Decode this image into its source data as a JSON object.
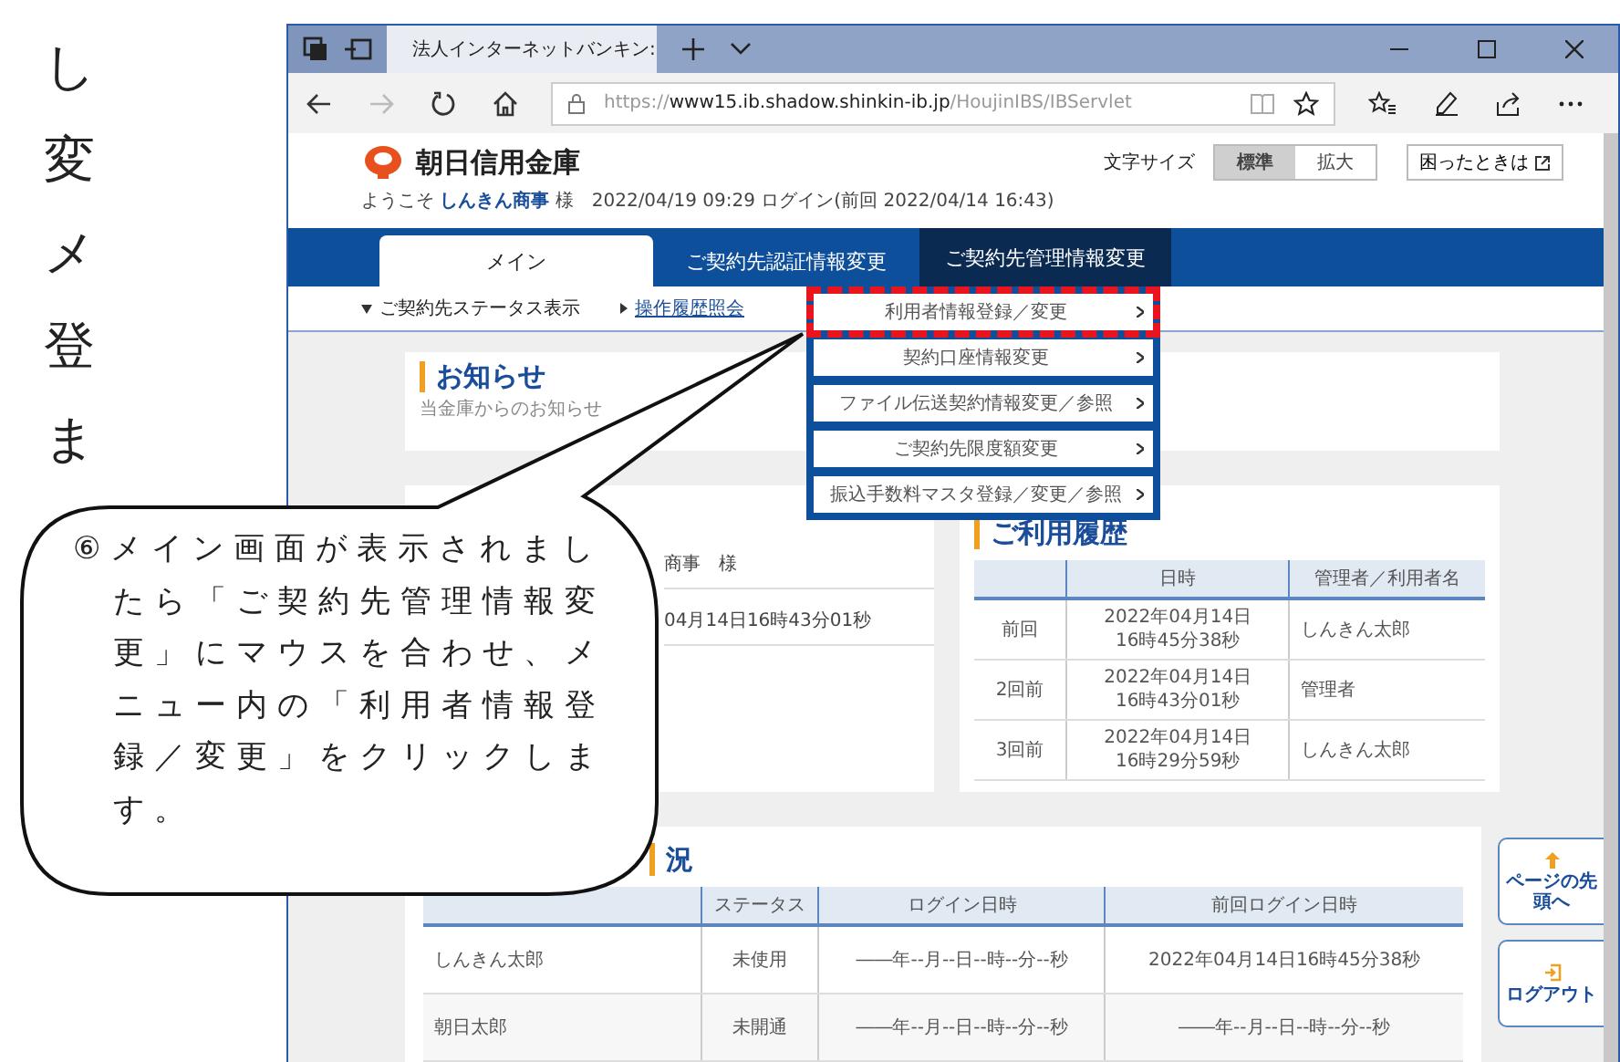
{
  "margin_text": [
    "し",
    "変",
    "メ",
    "登",
    "ま"
  ],
  "callout": {
    "text": "⑥メイン画面が表示されましたら「ご契約先管理情報変更」にマウスを合わせ、メニュー内の「利用者情報登録／変更」をクリックします。"
  },
  "browser": {
    "tab_title": "法人インターネットバンキン:",
    "url": {
      "scheme": "https://",
      "host": "www15.ib.shadow.shinkin-ib.jp",
      "path": "/HoujinIBS/IBServlet"
    }
  },
  "header": {
    "bank_name": "朝日信用金庫",
    "text_size_label": "文字サイズ",
    "text_sizes": [
      {
        "label": "標準",
        "selected": true
      },
      {
        "label": "拡大",
        "selected": false
      }
    ],
    "help_button": "困ったときは",
    "welcome": "ようこそ **しんきん商事** 様　2022/04/19 09:29 ログイン(前回 2022/04/14 16:43)"
  },
  "nav_tabs": [
    {
      "label": "メイン",
      "selected": true,
      "hovered": false
    },
    {
      "label": "ご契約先認証情報変更",
      "selected": false,
      "hovered": false
    },
    {
      "label": "ご契約先管理情報変更",
      "selected": false,
      "hovered": true
    }
  ],
  "sub_nav": [
    {
      "label": "ご契約先ステータス表示",
      "kind": "toggle"
    },
    {
      "label": "操作履歴照会",
      "kind": "link"
    }
  ],
  "dropdown_menu": [
    {
      "label": "利用者情報登録／変更",
      "highlighted": true
    },
    {
      "label": "契約口座情報変更",
      "highlighted": false
    },
    {
      "label": "ファイル伝送契約情報変更／参照",
      "highlighted": false
    },
    {
      "label": "ご契約先限度額変更",
      "highlighted": false
    },
    {
      "label": "振込手数料マスタ登録／変更／参照",
      "highlighted": false
    }
  ],
  "notice_card": {
    "title": "お知らせ",
    "text": "当金庫からのお知らせ"
  },
  "account_card": {
    "texts": [
      "商事　様",
      "04月14日16時43分01秒"
    ]
  },
  "history_card": {
    "title": "ご利用履歴",
    "columns": [
      "日時",
      "管理者／利用者名"
    ],
    "rows": [
      {
        "label": "前回",
        "date": "2022年04月14日",
        "time": "16時45分38秒",
        "user": "しんきん太郎"
      },
      {
        "label": "2回前",
        "date": "2022年04月14日",
        "time": "16時43分01秒",
        "user": "管理者"
      },
      {
        "label": "3回前",
        "date": "2022年04月14日",
        "time": "16時29分59秒",
        "user": "しんきん太郎"
      }
    ]
  },
  "status_card": {
    "title": "況",
    "columns": [
      "",
      "ステータス",
      "ログイン日時",
      "前回ログイン日時"
    ],
    "rows": [
      [
        "しんきん太郎",
        "未使用",
        "――年--月--日--時--分--秒",
        "2022年04月14日16時45分38秒"
      ],
      [
        "朝日太郎",
        "未開通",
        "――年--月--日--時--分--秒",
        "――年--月--日--時--分--秒"
      ]
    ]
  },
  "side_buttons": [
    {
      "label": "ページの先頭へ",
      "kind": "top"
    },
    {
      "label": "ログアウト",
      "kind": "logout"
    }
  ]
}
